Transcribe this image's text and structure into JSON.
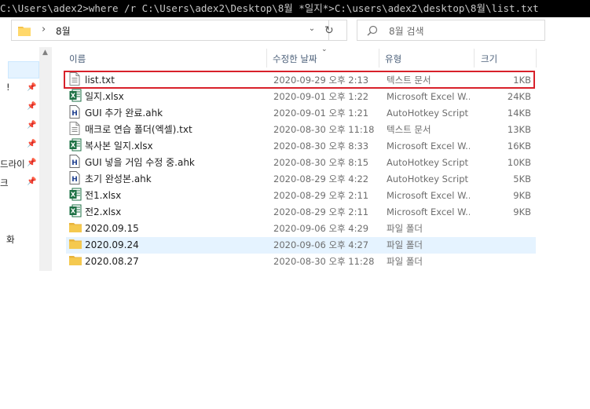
{
  "console": {
    "command_line": "C:\\Users\\adex2>where /r C:\\Users\\adex2\\Desktop\\8월 *일지*>C:\\users\\adex2\\desktop\\8월\\list.txt"
  },
  "address_bar": {
    "path": "8월",
    "search_placeholder": "8월 검색"
  },
  "columns": {
    "name": "이름",
    "date": "수정한 날짜",
    "type": "유형",
    "size": "크기"
  },
  "sidebar": {
    "labels": [
      "!",
      "드라이",
      "크",
      "화"
    ]
  },
  "files": [
    {
      "name": "list.txt",
      "date": "2020-09-29 오후 2:13",
      "type": "텍스트 문서",
      "size": "1KB",
      "icon": "text-file-icon"
    },
    {
      "name": "일지.xlsx",
      "date": "2020-09-01 오후 1:22",
      "type": "Microsoft Excel W...",
      "size": "24KB",
      "icon": "excel-file-icon"
    },
    {
      "name": "GUI 추가 완료.ahk",
      "date": "2020-09-01 오후 1:21",
      "type": "AutoHotkey Script",
      "size": "14KB",
      "icon": "ahk-file-icon"
    },
    {
      "name": "매크로 연습 폴더(엑셀).txt",
      "date": "2020-08-30 오후 11:18",
      "type": "텍스트 문서",
      "size": "13KB",
      "icon": "text-file-icon"
    },
    {
      "name": "복사본 일지.xlsx",
      "date": "2020-08-30 오후 8:33",
      "type": "Microsoft Excel W...",
      "size": "16KB",
      "icon": "excel-file-icon"
    },
    {
      "name": "GUI 넣을 거임 수정 중.ahk",
      "date": "2020-08-30 오후 8:15",
      "type": "AutoHotkey Script",
      "size": "10KB",
      "icon": "ahk-file-icon"
    },
    {
      "name": "초기 완성본.ahk",
      "date": "2020-08-29 오후 4:22",
      "type": "AutoHotkey Script",
      "size": "5KB",
      "icon": "ahk-file-icon"
    },
    {
      "name": "전1.xlsx",
      "date": "2020-08-29 오후 2:11",
      "type": "Microsoft Excel W...",
      "size": "9KB",
      "icon": "excel-file-icon"
    },
    {
      "name": "전2.xlsx",
      "date": "2020-08-29 오후 2:11",
      "type": "Microsoft Excel W...",
      "size": "9KB",
      "icon": "excel-file-icon"
    },
    {
      "name": "2020.09.15",
      "date": "2020-09-06 오후 4:29",
      "type": "파일 폴더",
      "size": "",
      "icon": "folder-icon"
    },
    {
      "name": "2020.09.24",
      "date": "2020-09-06 오후 4:27",
      "type": "파일 폴더",
      "size": "",
      "icon": "folder-icon"
    },
    {
      "name": "2020.08.27",
      "date": "2020-08-30 오후 11:28",
      "type": "파일 폴더",
      "size": "",
      "icon": "folder-icon"
    }
  ],
  "colors": {
    "highlight_border": "#d8212a",
    "hover_row": "#e5f3ff",
    "folder": "#f5c34a",
    "excel": "#1d7044"
  }
}
